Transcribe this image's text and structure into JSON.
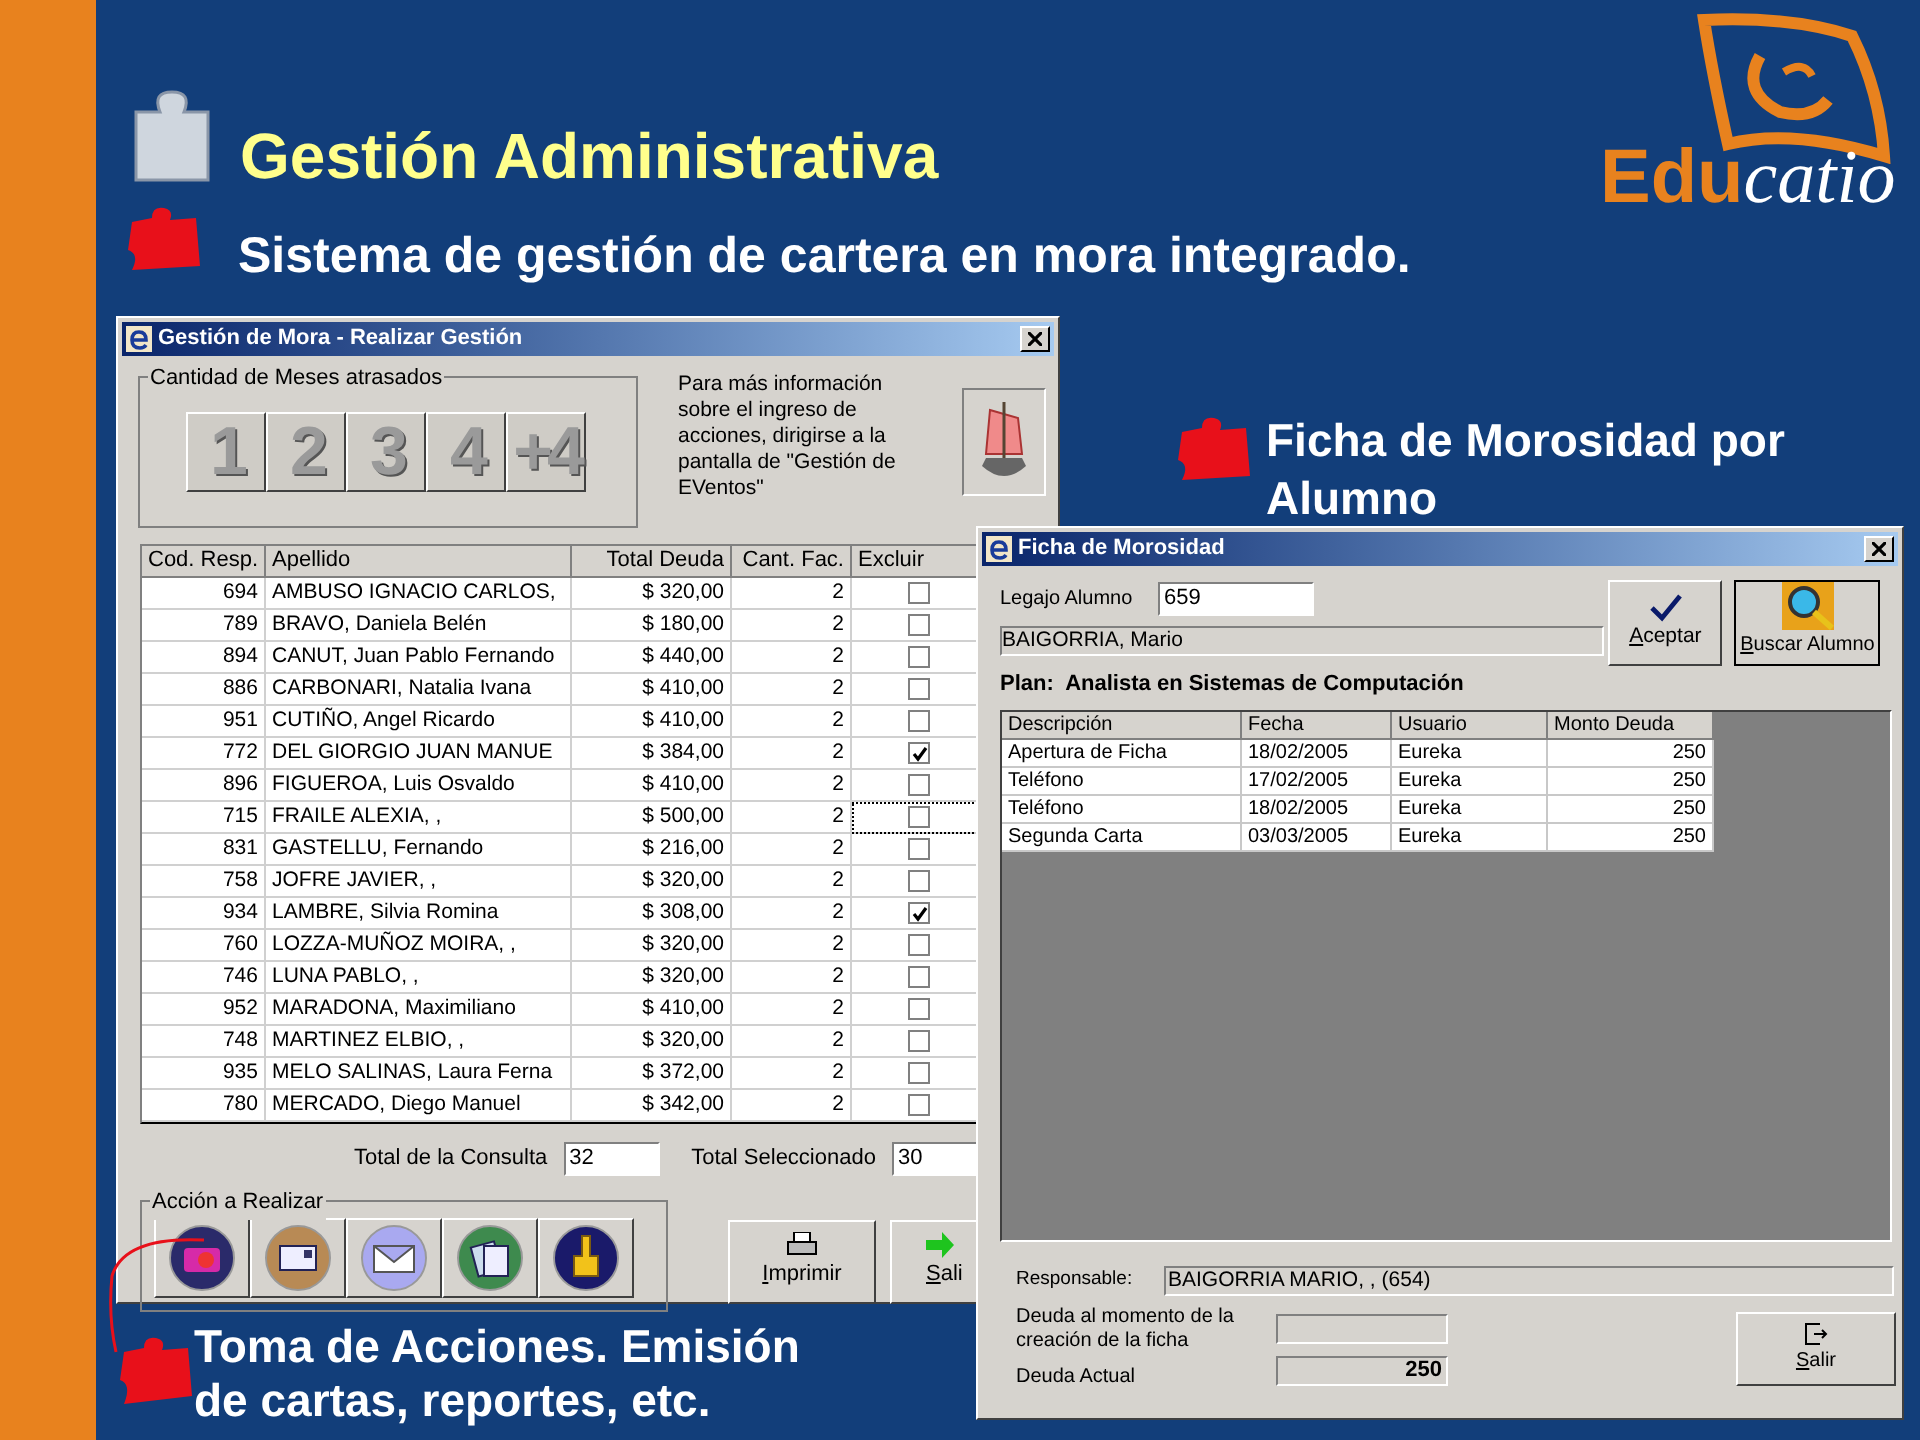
{
  "slide": {
    "title": "Gestión Administrativa",
    "subtitle": "Sistema de gestión de cartera en mora integrado.",
    "logo": {
      "part_1": "Edu",
      "part_2": "catio"
    }
  },
  "callouts": [
    {
      "text": "Ficha de Morosidad por Alumno"
    },
    {
      "text": "Toma de Acciones. Emisión de cartas, reportes, etc."
    }
  ],
  "gestion_window": {
    "title": "Gestión de Mora - Realizar Gestión",
    "months_group": {
      "label": "Cantidad de Meses atrasados",
      "buttons": [
        "1",
        "2",
        "3",
        "4",
        "+4"
      ]
    },
    "info_text": "Para más información sobre el ingreso de acciones, dirigirse a la pantalla de \"Gestión de EVentos\"",
    "table": {
      "columns": [
        "Cod. Resp.",
        "Apellido",
        "Total Deuda",
        "Cant. Fac.",
        "Excluir"
      ],
      "rows": [
        {
          "cod": "694",
          "apellido": "AMBUSO IGNACIO CARLOS,",
          "total": "$ 320,00",
          "cant": "2",
          "excluded": false,
          "focused": false
        },
        {
          "cod": "789",
          "apellido": "BRAVO, Daniela Belén",
          "total": "$ 180,00",
          "cant": "2",
          "excluded": false,
          "focused": false
        },
        {
          "cod": "894",
          "apellido": "CANUT, Juan Pablo Fernando",
          "total": "$ 440,00",
          "cant": "2",
          "excluded": false,
          "focused": false
        },
        {
          "cod": "886",
          "apellido": "CARBONARI, Natalia Ivana",
          "total": "$ 410,00",
          "cant": "2",
          "excluded": false,
          "focused": false
        },
        {
          "cod": "951",
          "apellido": "CUTIÑO, Angel Ricardo",
          "total": "$ 410,00",
          "cant": "2",
          "excluded": false,
          "focused": false
        },
        {
          "cod": "772",
          "apellido": "DEL GIORGIO JUAN MANUE",
          "total": "$ 384,00",
          "cant": "2",
          "excluded": true,
          "focused": false
        },
        {
          "cod": "896",
          "apellido": "FIGUEROA, Luis Osvaldo",
          "total": "$ 410,00",
          "cant": "2",
          "excluded": false,
          "focused": false
        },
        {
          "cod": "715",
          "apellido": "FRAILE ALEXIA, ,",
          "total": "$ 500,00",
          "cant": "2",
          "excluded": false,
          "focused": true
        },
        {
          "cod": "831",
          "apellido": "GASTELLU, Fernando",
          "total": "$ 216,00",
          "cant": "2",
          "excluded": false,
          "focused": false
        },
        {
          "cod": "758",
          "apellido": "JOFRE JAVIER, ,",
          "total": "$ 320,00",
          "cant": "2",
          "excluded": false,
          "focused": false
        },
        {
          "cod": "934",
          "apellido": "LAMBRE, Silvia Romina",
          "total": "$ 308,00",
          "cant": "2",
          "excluded": true,
          "focused": false
        },
        {
          "cod": "760",
          "apellido": "LOZZA-MUÑOZ MOIRA, ,",
          "total": "$ 320,00",
          "cant": "2",
          "excluded": false,
          "focused": false
        },
        {
          "cod": "746",
          "apellido": "LUNA PABLO, ,",
          "total": "$ 320,00",
          "cant": "2",
          "excluded": false,
          "focused": false
        },
        {
          "cod": "952",
          "apellido": "MARADONA, Maximiliano",
          "total": "$ 410,00",
          "cant": "2",
          "excluded": false,
          "focused": false
        },
        {
          "cod": "748",
          "apellido": "MARTINEZ ELBIO, ,",
          "total": "$ 320,00",
          "cant": "2",
          "excluded": false,
          "focused": false
        },
        {
          "cod": "935",
          "apellido": "MELO SALINAS, Laura Ferna",
          "total": "$ 372,00",
          "cant": "2",
          "excluded": false,
          "focused": false
        },
        {
          "cod": "780",
          "apellido": "MERCADO, Diego Manuel",
          "total": "$ 342,00",
          "cant": "2",
          "excluded": false,
          "focused": false
        }
      ]
    },
    "totals": [
      {
        "label": "Total de la Consulta",
        "value": "32"
      },
      {
        "label": "Total Seleccionado",
        "value": "30"
      }
    ],
    "actions_group": {
      "label": "Acción a Realizar"
    },
    "buttons": [
      "Imprimir",
      "Sali"
    ]
  },
  "ficha_window": {
    "title": "Ficha de Morosidad",
    "legajo": {
      "label": "Legajo Alumno",
      "value": "659"
    },
    "student_name": "BAIGORRIA, Mario",
    "plan": {
      "label": "Plan:",
      "value": "Analista en Sistemas de Computación"
    },
    "buttons": [
      "Aceptar",
      "Buscar Alumno"
    ],
    "table": {
      "columns": [
        "Descripción",
        "Fecha",
        "Usuario",
        "Monto Deuda"
      ],
      "rows": [
        [
          "Apertura de Ficha",
          "18/02/2005",
          "Eureka",
          "250"
        ],
        [
          "Teléfono",
          "17/02/2005",
          "Eureka",
          "250"
        ],
        [
          "Teléfono",
          "18/02/2005",
          "Eureka",
          "250"
        ],
        [
          "Segunda Carta",
          "03/03/2005",
          "Eureka",
          "250"
        ]
      ]
    },
    "responsable": {
      "label": "Responsable:",
      "value": "BAIGORRIA MARIO, , (654)"
    },
    "deuda_inicial": {
      "label": "Deuda al momento de la creación de la ficha"
    },
    "deuda_actual": {
      "label": "Deuda Actual",
      "value": "250"
    },
    "exit_button": "Salir"
  }
}
